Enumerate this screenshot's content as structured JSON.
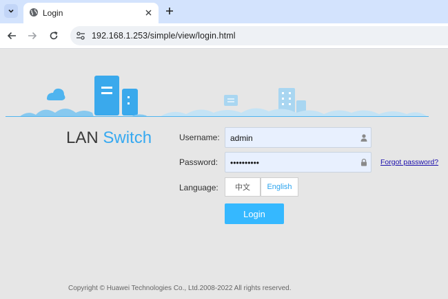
{
  "browser": {
    "tab": {
      "title": "Login"
    },
    "address_bar": {
      "url": "192.168.1.253/simple/view/login.html"
    },
    "icons": {
      "tab_search": "chevron-down-icon",
      "favicon": "globe-icon",
      "close": "close-icon",
      "new_tab": "plus-icon",
      "back": "arrow-left-icon",
      "forward": "arrow-right-icon",
      "reload": "reload-icon",
      "site_info": "tune-icon"
    }
  },
  "brand": {
    "part1": "LAN",
    "part2": "Switch",
    "accent_color": "#36a9f1"
  },
  "form": {
    "username": {
      "label": "Username:",
      "value": "admin",
      "icon": "user-icon"
    },
    "password": {
      "label": "Password:",
      "value": "••••••••••",
      "icon": "lock-icon"
    },
    "forgot_password": "Forgot password?",
    "language": {
      "label": "Language:",
      "options": [
        "中文",
        "English"
      ],
      "selected": "English"
    },
    "login_button": "Login",
    "login_button_color": "#35b8ff"
  },
  "footer": {
    "copyright": "Copyright © Huawei Technologies Co., Ltd.2008-2022 All rights reserved."
  }
}
